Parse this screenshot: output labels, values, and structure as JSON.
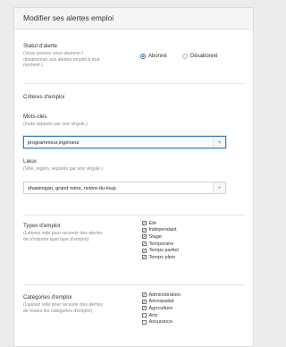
{
  "header": {
    "title": "Modifier ses alertes emploi"
  },
  "status": {
    "label": "Statut d'alerte",
    "help": [
      "(Vous pouvez vous abonner /",
      "désabonner aux alertes emploi à tout",
      "moment.)"
    ],
    "options": [
      {
        "label": "Abonné",
        "checked": true
      },
      {
        "label": "Désabonné",
        "checked": false
      }
    ]
  },
  "criteria": {
    "title": "Critères d'emploi",
    "keywords": {
      "label": "Mots-clés",
      "help": "(mots séparés par une virgule.)",
      "value": "programmeur,ingénieur",
      "icon": "tag-icon"
    },
    "locations": {
      "label": "Lieux",
      "help": "(Ville, région, séparés par une virgule.)",
      "value": "shawinigan, grand mère, rivière-du-loup",
      "icon": "location-icon"
    }
  },
  "job_types": {
    "label": "Types d'emploi",
    "help": [
      "(Laissez vide pour recevoir des alertes",
      "de n'importe quel type d'emploi)"
    ],
    "items": [
      {
        "label": "Été",
        "checked": true
      },
      {
        "label": "Indépendant",
        "checked": true
      },
      {
        "label": "Stage",
        "checked": true
      },
      {
        "label": "Temporaire",
        "checked": true
      },
      {
        "label": "Temps partiel",
        "checked": true
      },
      {
        "label": "Temps plein",
        "checked": true
      }
    ]
  },
  "categories": {
    "label": "Catégories d'emploi",
    "help": [
      "(Laissez vide pour recevoir des alertes",
      "de toutes les catégories d'emploi)"
    ],
    "items": [
      {
        "label": "Administration",
        "checked": true
      },
      {
        "label": "Aérospatial",
        "checked": true
      },
      {
        "label": "Agriculture",
        "checked": true
      },
      {
        "label": "Arts",
        "checked": false
      },
      {
        "label": "Assurance",
        "checked": false
      }
    ]
  },
  "colors": {
    "accent": "#1c6fb5",
    "focus_border": "#2f80c8"
  }
}
